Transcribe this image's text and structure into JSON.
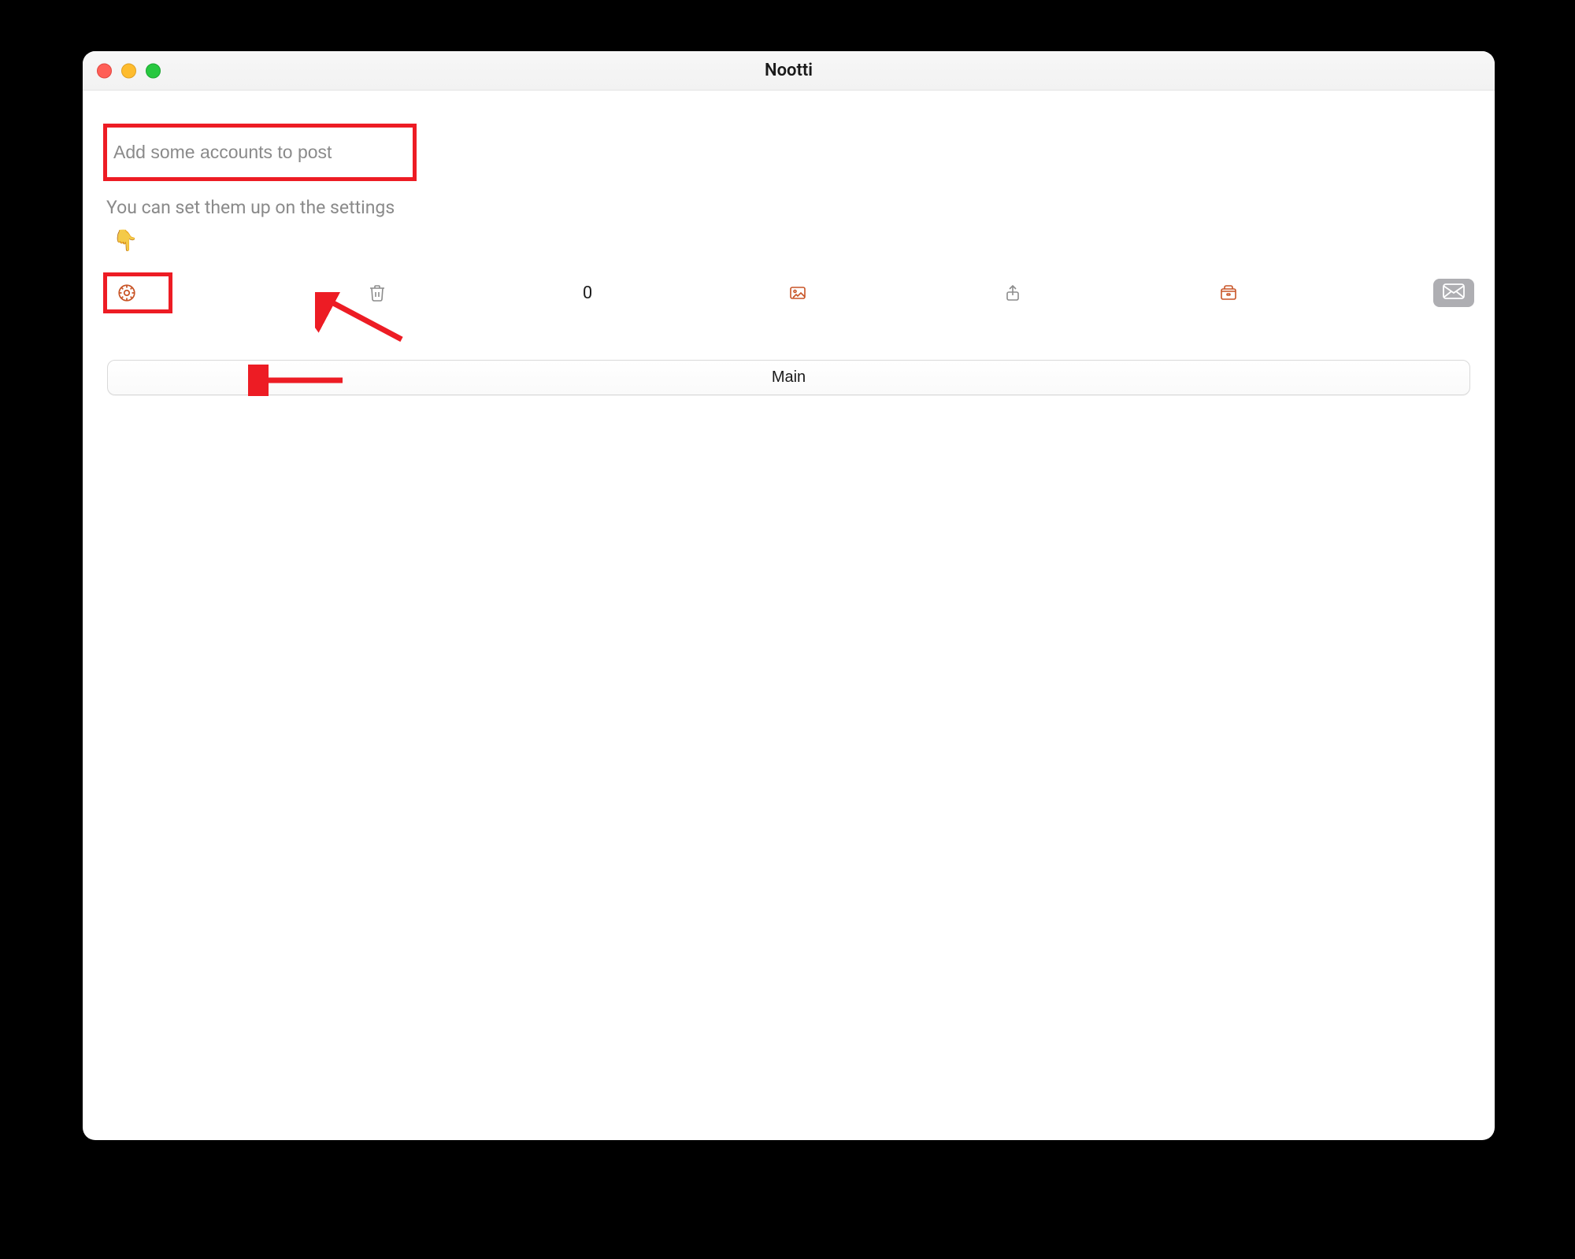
{
  "window": {
    "title": "Nootti"
  },
  "compose": {
    "placeholder": "Add some accounts to post",
    "hint": "You can set them up on the settings",
    "pointer": "👇"
  },
  "toolbar": {
    "settings_icon": "settings",
    "trash_icon": "trash",
    "count": "0",
    "image_icon": "image",
    "share_icon": "share",
    "archive_icon": "archive",
    "send_icon": "mail"
  },
  "main_button": {
    "label": "Main"
  }
}
